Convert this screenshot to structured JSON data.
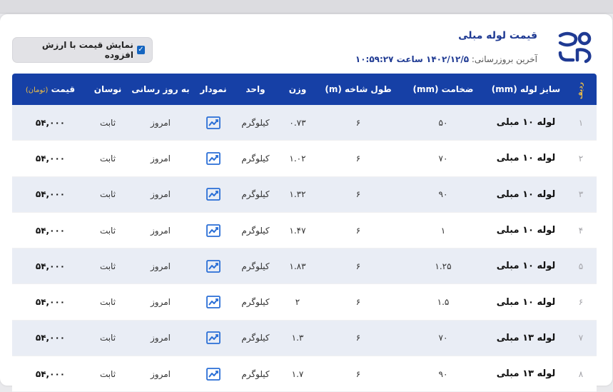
{
  "header": {
    "title": "قیمت لوله مبلی",
    "last_update_label": "آخرین بروزرسانی:",
    "last_update_value": "۱۴۰۲/۱۲/۵ ساعت ۱۰:۵۹:۲۷"
  },
  "vat_toggle": {
    "label": "نمایش قیمت با ارزش افزوده",
    "checked": true
  },
  "colors": {
    "brand": "#1f3a93",
    "header_bg": "#1640a6",
    "accent": "#f2c044"
  },
  "table": {
    "columns": {
      "index": "ردیف",
      "size": "سایز لوله (mm)",
      "thickness": "ضخامت (mm)",
      "length": "طول شاخه (m)",
      "weight": "وزن",
      "unit": "واحد",
      "chart": "نمودار",
      "updated": "به روز رسانی",
      "change": "نوسان",
      "price": "قیمت",
      "price_unit": "(تومان)"
    },
    "rows": [
      {
        "index": "۱",
        "size": "لوله ۱۰ مبلی",
        "thickness": "۵۰",
        "length": "۶",
        "weight": "۰.۷۳",
        "unit": "کیلوگرم",
        "updated": "امروز",
        "change": "ثابت",
        "price": "۵۴,۰۰۰"
      },
      {
        "index": "۲",
        "size": "لوله ۱۰ مبلی",
        "thickness": "۷۰",
        "length": "۶",
        "weight": "۱.۰۲",
        "unit": "کیلوگرم",
        "updated": "امروز",
        "change": "ثابت",
        "price": "۵۴,۰۰۰"
      },
      {
        "index": "۳",
        "size": "لوله ۱۰ مبلی",
        "thickness": "۹۰",
        "length": "۶",
        "weight": "۱.۳۲",
        "unit": "کیلوگرم",
        "updated": "امروز",
        "change": "ثابت",
        "price": "۵۴,۰۰۰"
      },
      {
        "index": "۴",
        "size": "لوله ۱۰ مبلی",
        "thickness": "۱",
        "length": "۶",
        "weight": "۱.۴۷",
        "unit": "کیلوگرم",
        "updated": "امروز",
        "change": "ثابت",
        "price": "۵۴,۰۰۰"
      },
      {
        "index": "۵",
        "size": "لوله ۱۰ مبلی",
        "thickness": "۱.۲۵",
        "length": "۶",
        "weight": "۱.۸۳",
        "unit": "کیلوگرم",
        "updated": "امروز",
        "change": "ثابت",
        "price": "۵۴,۰۰۰"
      },
      {
        "index": "۶",
        "size": "لوله ۱۰ مبلی",
        "thickness": "۱.۵",
        "length": "۶",
        "weight": "۲",
        "unit": "کیلوگرم",
        "updated": "امروز",
        "change": "ثابت",
        "price": "۵۴,۰۰۰"
      },
      {
        "index": "۷",
        "size": "لوله ۱۳ مبلی",
        "thickness": "۷۰",
        "length": "۶",
        "weight": "۱.۳",
        "unit": "کیلوگرم",
        "updated": "امروز",
        "change": "ثابت",
        "price": "۵۴,۰۰۰"
      },
      {
        "index": "۸",
        "size": "لوله ۱۳ مبلی",
        "thickness": "۹۰",
        "length": "۶",
        "weight": "۱.۷",
        "unit": "کیلوگرم",
        "updated": "امروز",
        "change": "ثابت",
        "price": "۵۴,۰۰۰"
      }
    ]
  },
  "icons": {
    "logo": "brand-logo-icon",
    "chart": "chart-trend-icon"
  }
}
